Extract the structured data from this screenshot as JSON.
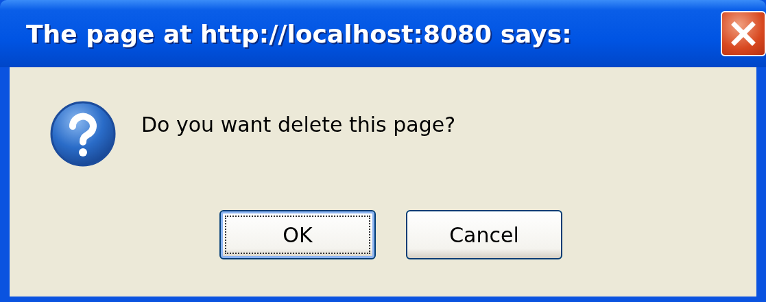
{
  "window": {
    "title": "The page at http://localhost:8080 says:"
  },
  "message": "Do you want delete this page?",
  "buttons": [
    {
      "label": "OK",
      "focused": true
    },
    {
      "label": "Cancel",
      "focused": false
    }
  ]
}
